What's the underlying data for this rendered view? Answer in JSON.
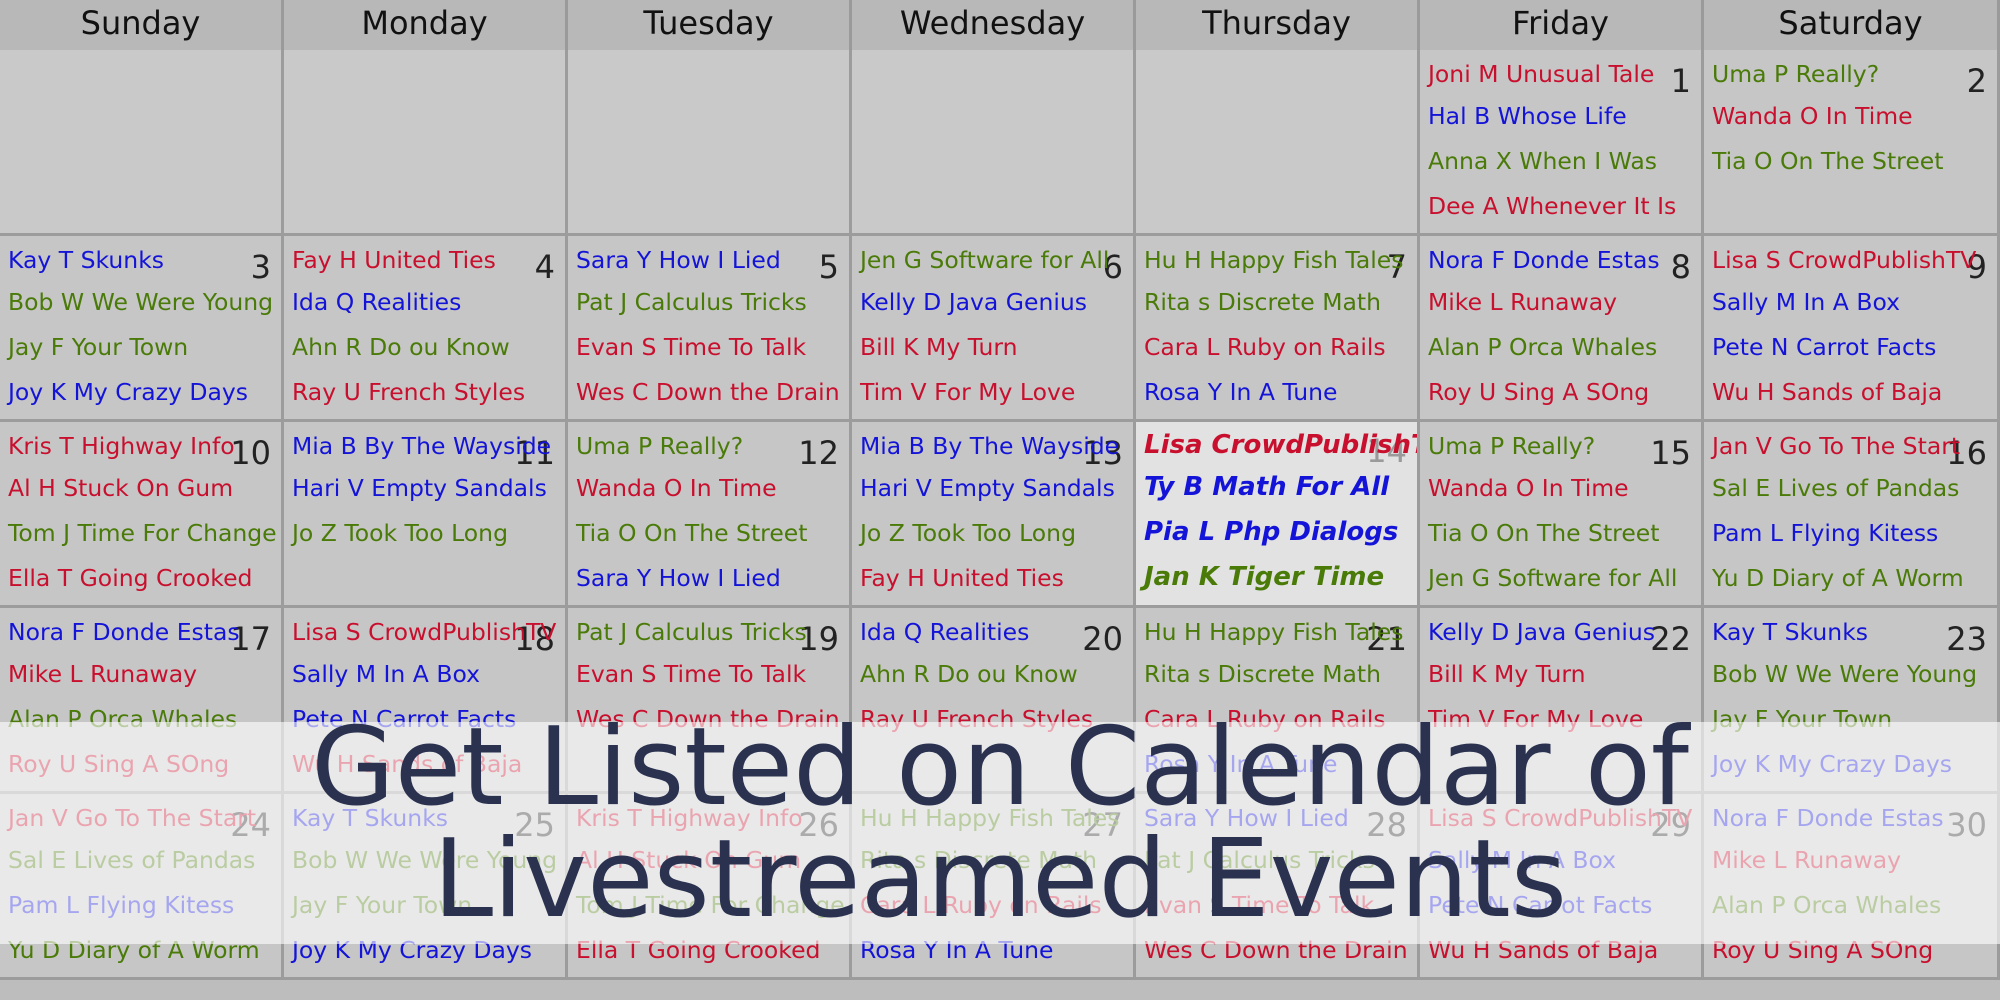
{
  "colors": {
    "red": "#c8102e",
    "blue": "#1414d8",
    "green": "#4a7a08"
  },
  "day_names": [
    "Sunday",
    "Monday",
    "Tuesday",
    "Wednesday",
    "Thursday",
    "Friday",
    "Saturday"
  ],
  "today": 14,
  "weeks": [
    [
      null,
      null,
      null,
      null,
      null,
      {
        "day": "1",
        "events": [
          {
            "t": "Joni M Unusual Tale",
            "c": "red"
          },
          {
            "t": "Hal B Whose Life",
            "c": "blue"
          },
          {
            "t": "Anna X When I Was",
            "c": "green"
          },
          {
            "t": "Dee A Whenever It Is",
            "c": "red"
          }
        ]
      },
      {
        "day": "2",
        "events": [
          {
            "t": "Uma P Really?",
            "c": "green"
          },
          {
            "t": "Wanda O In Time",
            "c": "red"
          },
          {
            "t": "Tia O On The Street",
            "c": "green"
          }
        ]
      }
    ],
    [
      {
        "day": "3",
        "events": [
          {
            "t": "Kay T Skunks",
            "c": "blue"
          },
          {
            "t": "Bob W We Were Young",
            "c": "green"
          },
          {
            "t": "Jay F Your Town",
            "c": "green"
          },
          {
            "t": "Joy K My Crazy Days",
            "c": "blue"
          }
        ]
      },
      {
        "day": "4",
        "events": [
          {
            "t": "Fay H United Ties",
            "c": "red"
          },
          {
            "t": "Ida Q Realities",
            "c": "blue"
          },
          {
            "t": "Ahn R Do ou Know",
            "c": "green"
          },
          {
            "t": "Ray U French Styles",
            "c": "red"
          }
        ]
      },
      {
        "day": "5",
        "events": [
          {
            "t": "Sara Y How I Lied",
            "c": "blue"
          },
          {
            "t": "Pat J Calculus Tricks",
            "c": "green"
          },
          {
            "t": "Evan S Time To Talk",
            "c": "red"
          },
          {
            "t": "Wes C Down the Drain",
            "c": "red"
          }
        ]
      },
      {
        "day": "6",
        "events": [
          {
            "t": "Jen G Software for All",
            "c": "green"
          },
          {
            "t": "Kelly D Java Genius",
            "c": "blue"
          },
          {
            "t": "Bill K My Turn",
            "c": "red"
          },
          {
            "t": "Tim V For My Love",
            "c": "red"
          }
        ]
      },
      {
        "day": "7",
        "events": [
          {
            "t": "Hu H Happy Fish Tales",
            "c": "green"
          },
          {
            "t": "Rita s Discrete Math",
            "c": "green"
          },
          {
            "t": "Cara L Ruby on Rails",
            "c": "red"
          },
          {
            "t": "Rosa Y In A Tune",
            "c": "blue"
          }
        ]
      },
      {
        "day": "8",
        "events": [
          {
            "t": "Nora F Donde Estas",
            "c": "blue"
          },
          {
            "t": "Mike L Runaway",
            "c": "red"
          },
          {
            "t": "Alan P Orca Whales",
            "c": "green"
          },
          {
            "t": "Roy U Sing A SOng",
            "c": "red"
          }
        ]
      },
      {
        "day": "9",
        "events": [
          {
            "t": "Lisa S CrowdPublishTV",
            "c": "red"
          },
          {
            "t": "Sally M In A Box",
            "c": "blue"
          },
          {
            "t": "Pete N Carrot Facts",
            "c": "blue"
          },
          {
            "t": "Wu H Sands of Baja",
            "c": "red"
          }
        ]
      }
    ],
    [
      {
        "day": "10",
        "events": [
          {
            "t": "Kris T Highway Info",
            "c": "red"
          },
          {
            "t": "Al H Stuck On Gum",
            "c": "red"
          },
          {
            "t": "Tom J Time For Change",
            "c": "green"
          },
          {
            "t": "Ella T Going Crooked",
            "c": "red"
          }
        ]
      },
      {
        "day": "11",
        "events": [
          {
            "t": "Mia B By The Wayside",
            "c": "blue"
          },
          {
            "t": "Hari V Empty Sandals",
            "c": "blue"
          },
          {
            "t": "Jo Z Took Too Long",
            "c": "green"
          }
        ]
      },
      {
        "day": "12",
        "events": [
          {
            "t": "Uma P Really?",
            "c": "green"
          },
          {
            "t": "Wanda O In Time",
            "c": "red"
          },
          {
            "t": "Tia O On The Street",
            "c": "green"
          },
          {
            "t": "Sara Y How I Lied",
            "c": "blue"
          }
        ]
      },
      {
        "day": "13",
        "events": [
          {
            "t": "Mia B By The Wayside",
            "c": "blue"
          },
          {
            "t": "Hari V Empty Sandals",
            "c": "blue"
          },
          {
            "t": "Jo Z Took Too Long",
            "c": "green"
          },
          {
            "t": "Fay H United Ties",
            "c": "red"
          }
        ]
      },
      {
        "day": "14",
        "events": [
          {
            "t": "Lisa CrowdPublishTV",
            "c": "red"
          },
          {
            "t": "Ty B Math For All",
            "c": "blue"
          },
          {
            "t": "Pia L Php Dialogs",
            "c": "blue"
          },
          {
            "t": "Jan K Tiger Time",
            "c": "green"
          }
        ]
      },
      {
        "day": "15",
        "events": [
          {
            "t": "Uma P Really?",
            "c": "green"
          },
          {
            "t": "Wanda O In Time",
            "c": "red"
          },
          {
            "t": "Tia O On The Street",
            "c": "green"
          },
          {
            "t": "Jen G Software for All",
            "c": "green"
          }
        ]
      },
      {
        "day": "16",
        "events": [
          {
            "t": "Jan V Go To The Start",
            "c": "red"
          },
          {
            "t": "Sal E Lives of Pandas",
            "c": "green"
          },
          {
            "t": "Pam L Flying Kitess",
            "c": "blue"
          },
          {
            "t": "Yu D Diary of A Worm",
            "c": "green"
          }
        ]
      }
    ],
    [
      {
        "day": "17",
        "events": [
          {
            "t": "Nora F Donde Estas",
            "c": "blue"
          },
          {
            "t": "Mike L Runaway",
            "c": "red"
          },
          {
            "t": "Alan P Orca Whales",
            "c": "green"
          },
          {
            "t": "Roy U Sing A SOng",
            "c": "red"
          }
        ]
      },
      {
        "day": "18",
        "events": [
          {
            "t": "Lisa S CrowdPublishTV",
            "c": "red"
          },
          {
            "t": "Sally M In A Box",
            "c": "blue"
          },
          {
            "t": "Pete N Carrot Facts",
            "c": "blue"
          },
          {
            "t": "Wu H Sands of Baja",
            "c": "red"
          }
        ]
      },
      {
        "day": "19",
        "events": [
          {
            "t": "Pat J Calculus Tricks",
            "c": "green"
          },
          {
            "t": "Evan S Time To Talk",
            "c": "red"
          },
          {
            "t": "Wes C Down the Drain",
            "c": "red"
          }
        ]
      },
      {
        "day": "20",
        "events": [
          {
            "t": "Ida Q Realities",
            "c": "blue"
          },
          {
            "t": "Ahn R Do ou Know",
            "c": "green"
          },
          {
            "t": "Ray U French Styles",
            "c": "red"
          }
        ]
      },
      {
        "day": "21",
        "events": [
          {
            "t": "Hu H Happy Fish Tales",
            "c": "green"
          },
          {
            "t": "Rita s Discrete Math",
            "c": "green"
          },
          {
            "t": "Cara L Ruby on Rails",
            "c": "red"
          },
          {
            "t": "Rosa Y In A Tune",
            "c": "blue"
          }
        ]
      },
      {
        "day": "22",
        "events": [
          {
            "t": "Kelly D Java Genius",
            "c": "blue"
          },
          {
            "t": "Bill K My Turn",
            "c": "red"
          },
          {
            "t": "Tim V For My Love",
            "c": "red"
          }
        ]
      },
      {
        "day": "23",
        "events": [
          {
            "t": "Kay T Skunks",
            "c": "blue"
          },
          {
            "t": "Bob W We Were Young",
            "c": "green"
          },
          {
            "t": "Jay F Your Town",
            "c": "green"
          },
          {
            "t": "Joy K My Crazy Days",
            "c": "blue"
          }
        ]
      }
    ],
    [
      {
        "day": "24",
        "events": [
          {
            "t": "Jan V Go To The Start",
            "c": "red"
          },
          {
            "t": "Sal E Lives of Pandas",
            "c": "green"
          },
          {
            "t": "Pam L Flying Kitess",
            "c": "blue"
          },
          {
            "t": "Yu D Diary of A Worm",
            "c": "green"
          }
        ]
      },
      {
        "day": "25",
        "events": [
          {
            "t": "Kay T Skunks",
            "c": "blue"
          },
          {
            "t": "Bob W We Were Young",
            "c": "green"
          },
          {
            "t": "Jay F Your Town",
            "c": "green"
          },
          {
            "t": "Joy K My Crazy Days",
            "c": "blue"
          }
        ]
      },
      {
        "day": "26",
        "events": [
          {
            "t": "Kris T Highway Info",
            "c": "red"
          },
          {
            "t": "Al H Stuck On Gum",
            "c": "red"
          },
          {
            "t": "Tom J Time For Change",
            "c": "green"
          },
          {
            "t": "Ella T Going Crooked",
            "c": "red"
          }
        ]
      },
      {
        "day": "27",
        "events": [
          {
            "t": "Hu H Happy Fish Tales",
            "c": "green"
          },
          {
            "t": "Rita s Discrete Math",
            "c": "green"
          },
          {
            "t": "Cara L Ruby on Rails",
            "c": "red"
          },
          {
            "t": "Rosa Y In A Tune",
            "c": "blue"
          }
        ]
      },
      {
        "day": "28",
        "events": [
          {
            "t": "Sara Y How I Lied",
            "c": "blue"
          },
          {
            "t": "Pat J Calculus Tricks",
            "c": "green"
          },
          {
            "t": "Evan S Time To Talk",
            "c": "red"
          },
          {
            "t": "Wes C Down the Drain",
            "c": "red"
          }
        ]
      },
      {
        "day": "29",
        "events": [
          {
            "t": "Lisa S CrowdPublishTV",
            "c": "red"
          },
          {
            "t": "Sally M In A Box",
            "c": "blue"
          },
          {
            "t": "Pete N Carrot Facts",
            "c": "blue"
          },
          {
            "t": "Wu H Sands of Baja",
            "c": "red"
          }
        ]
      },
      {
        "day": "30",
        "events": [
          {
            "t": "Nora F Donde Estas",
            "c": "blue"
          },
          {
            "t": "Mike L Runaway",
            "c": "red"
          },
          {
            "t": "Alan P Orca Whales",
            "c": "green"
          },
          {
            "t": "Roy U Sing A SOng",
            "c": "red"
          }
        ]
      }
    ]
  ],
  "overlay": {
    "line1": "Get Listed on Calendar of",
    "line2": "Livestreamed Events"
  }
}
